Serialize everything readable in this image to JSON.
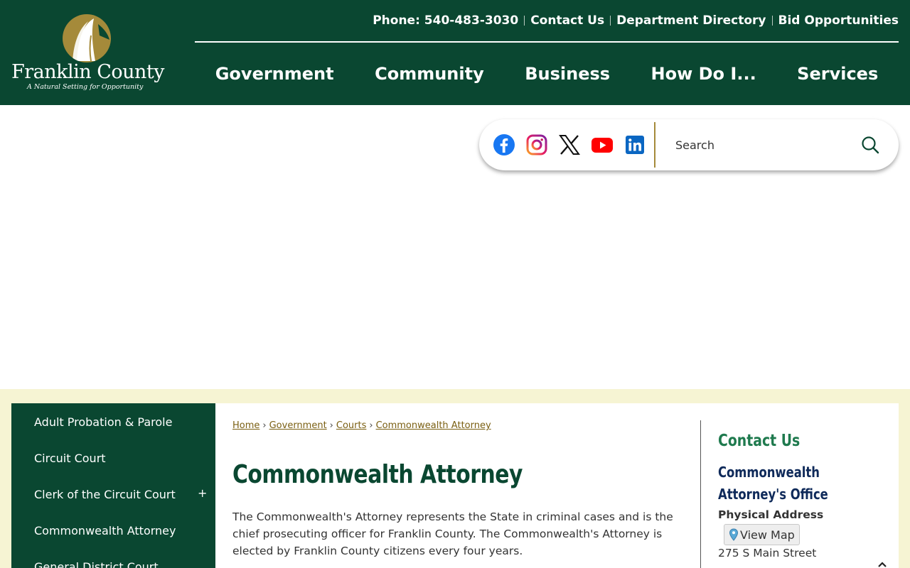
{
  "header": {
    "logo": {
      "name": "Franklin County",
      "tagline": "A Natural Setting for Opportunity"
    },
    "utility": {
      "phone": "Phone: 540-483-3030",
      "contact": "Contact Us",
      "directory": "Department Directory",
      "bids": "Bid Opportunities"
    },
    "nav": [
      "Government",
      "Community",
      "Business",
      "How Do I...",
      "Services"
    ]
  },
  "social": {
    "icons": [
      "facebook-icon",
      "instagram-icon",
      "x-icon",
      "youtube-icon",
      "linkedin-icon"
    ],
    "search": {
      "placeholder": "Search"
    }
  },
  "sidebar": {
    "items": [
      {
        "label": "Adult Probation & Parole"
      },
      {
        "label": "Circuit Court"
      },
      {
        "label": "Clerk of the Circuit Court",
        "toggle": "+"
      },
      {
        "label": "Commonwealth Attorney"
      },
      {
        "label": "General District Court"
      }
    ]
  },
  "main": {
    "breadcrumb": [
      "Home",
      "Government",
      "Courts",
      "Commonwealth Attorney"
    ],
    "title": "Commonwealth Attorney",
    "intro": "The Commonwealth's Attorney represents the State in criminal cases and is the chief prosecuting officer for Franklin County. The Commonwealth's Attorney is elected by Franklin County citizens every four years."
  },
  "aside": {
    "title": "Contact Us",
    "org": "Commonwealth Attorney's Office",
    "address_label": "Physical Address",
    "map_button": "View Map",
    "street": "275 S Main Street"
  },
  "colors": {
    "brand_green": "#0a4731",
    "brand_gold": "#a58a3a",
    "band_cream": "#f6f4d3",
    "link_gold": "#7a5f12",
    "aside_title_green": "#1f7a4e",
    "aside_org_navy": "#0f2a5a"
  }
}
